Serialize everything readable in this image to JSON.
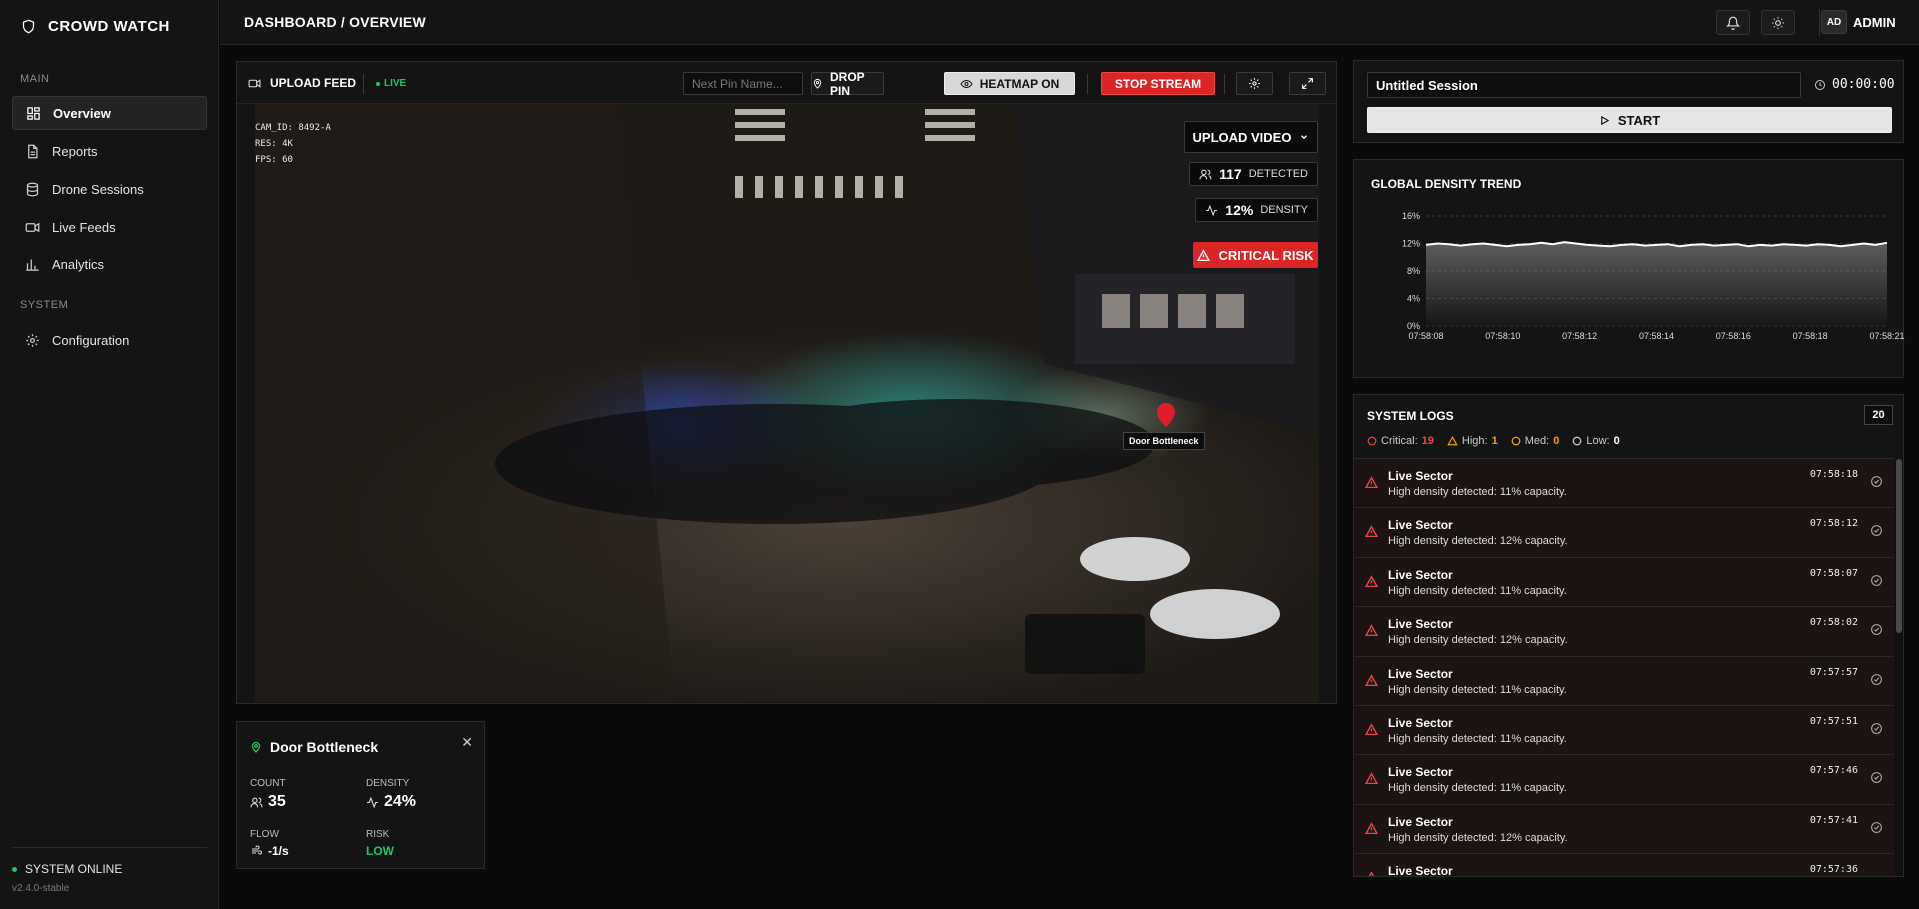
{
  "app": {
    "name": "CROWD WATCH"
  },
  "sidebar": {
    "main_label": "MAIN",
    "system_label": "SYSTEM",
    "items": [
      {
        "label": "Overview",
        "icon": "grid-icon"
      },
      {
        "label": "Reports",
        "icon": "document-icon"
      },
      {
        "label": "Drone Sessions",
        "icon": "database-icon"
      },
      {
        "label": "Live Feeds",
        "icon": "video-icon"
      },
      {
        "label": "Analytics",
        "icon": "chart-icon"
      }
    ],
    "config": {
      "label": "Configuration",
      "icon": "gear-icon"
    },
    "status": "SYSTEM ONLINE",
    "version": "v2.4.0-stable"
  },
  "header": {
    "breadcrumb": "DASHBOARD / OVERVIEW",
    "user_initials": "AD",
    "user_name": "ADMIN"
  },
  "feed": {
    "upload_label": "UPLOAD FEED",
    "live_label": "LIVE",
    "pin_placeholder": "Next Pin Name...",
    "drop_pin": "DROP PIN",
    "heatmap": "HEATMAP ON",
    "stop_stream": "STOP STREAM",
    "cam_id": "CAM_ID: 8492-A",
    "res": "RES: 4K",
    "fps": "FPS: 60",
    "upload_video": "UPLOAD VIDEO",
    "detected_count": "117",
    "detected_label": "DETECTED",
    "density_value": "12%",
    "density_label": "DENSITY",
    "risk": "CRITICAL RISK",
    "pin_label": "Door Bottleneck"
  },
  "pin_card": {
    "title": "Door Bottleneck",
    "count_label": "COUNT",
    "count": "35",
    "density_label": "DENSITY",
    "density": "24%",
    "flow_label": "FLOW",
    "flow": "-1/s",
    "risk_label": "RISK",
    "risk": "LOW"
  },
  "session": {
    "name": "Untitled Session",
    "timer": "00:00:00",
    "start": "START"
  },
  "trend": {
    "title": "GLOBAL DENSITY TREND"
  },
  "chart_data": {
    "type": "area",
    "title": "GLOBAL DENSITY TREND",
    "xlabel": "",
    "ylabel": "",
    "ylim": [
      0,
      16
    ],
    "yticks": [
      "0%",
      "4%",
      "8%",
      "12%",
      "16%"
    ],
    "x": [
      "07:58:08",
      "07:58:10",
      "07:58:12",
      "07:58:14",
      "07:58:16",
      "07:58:18",
      "07:58:21"
    ],
    "series": [
      {
        "values": [
          11.8,
          12.0,
          11.9,
          11.7,
          11.9,
          12.0,
          11.8,
          11.6,
          11.8,
          11.9,
          12.1,
          11.9,
          12.2,
          12.0,
          11.8,
          11.7,
          11.6,
          11.8,
          11.9,
          11.7,
          11.8,
          11.9,
          11.6,
          11.8,
          11.9,
          11.7,
          11.8,
          11.9,
          11.6,
          11.8,
          11.7,
          11.9,
          11.8,
          11.7,
          11.9,
          11.8,
          11.6,
          11.8,
          12.0,
          11.8,
          12.1
        ]
      }
    ],
    "grid": true,
    "legend": "none",
    "line_color": "#ffffff"
  },
  "logs": {
    "title": "SYSTEM LOGS",
    "count": "20",
    "severity": {
      "critical_label": "Critical:",
      "critical": "19",
      "high_label": "High:",
      "high": "1",
      "med_label": "Med:",
      "med": "0",
      "low_label": "Low:",
      "low": "0"
    },
    "entries": [
      {
        "source": "Live Sector",
        "message": "High density detected: 11% capacity.",
        "time": "07:58:18"
      },
      {
        "source": "Live Sector",
        "message": "High density detected: 12% capacity.",
        "time": "07:58:12"
      },
      {
        "source": "Live Sector",
        "message": "High density detected: 11% capacity.",
        "time": "07:58:07"
      },
      {
        "source": "Live Sector",
        "message": "High density detected: 12% capacity.",
        "time": "07:58:02"
      },
      {
        "source": "Live Sector",
        "message": "High density detected: 11% capacity.",
        "time": "07:57:57"
      },
      {
        "source": "Live Sector",
        "message": "High density detected: 11% capacity.",
        "time": "07:57:51"
      },
      {
        "source": "Live Sector",
        "message": "High density detected: 11% capacity.",
        "time": "07:57:46"
      },
      {
        "source": "Live Sector",
        "message": "High density detected: 12% capacity.",
        "time": "07:57:41"
      },
      {
        "source": "Live Sector",
        "message": "",
        "time": "07:57:36"
      }
    ]
  },
  "colors": {
    "critical": "#ef4444",
    "high": "#f59e0b",
    "success": "#22c55e",
    "background": "#0b0b0b",
    "panel": "#141414"
  }
}
